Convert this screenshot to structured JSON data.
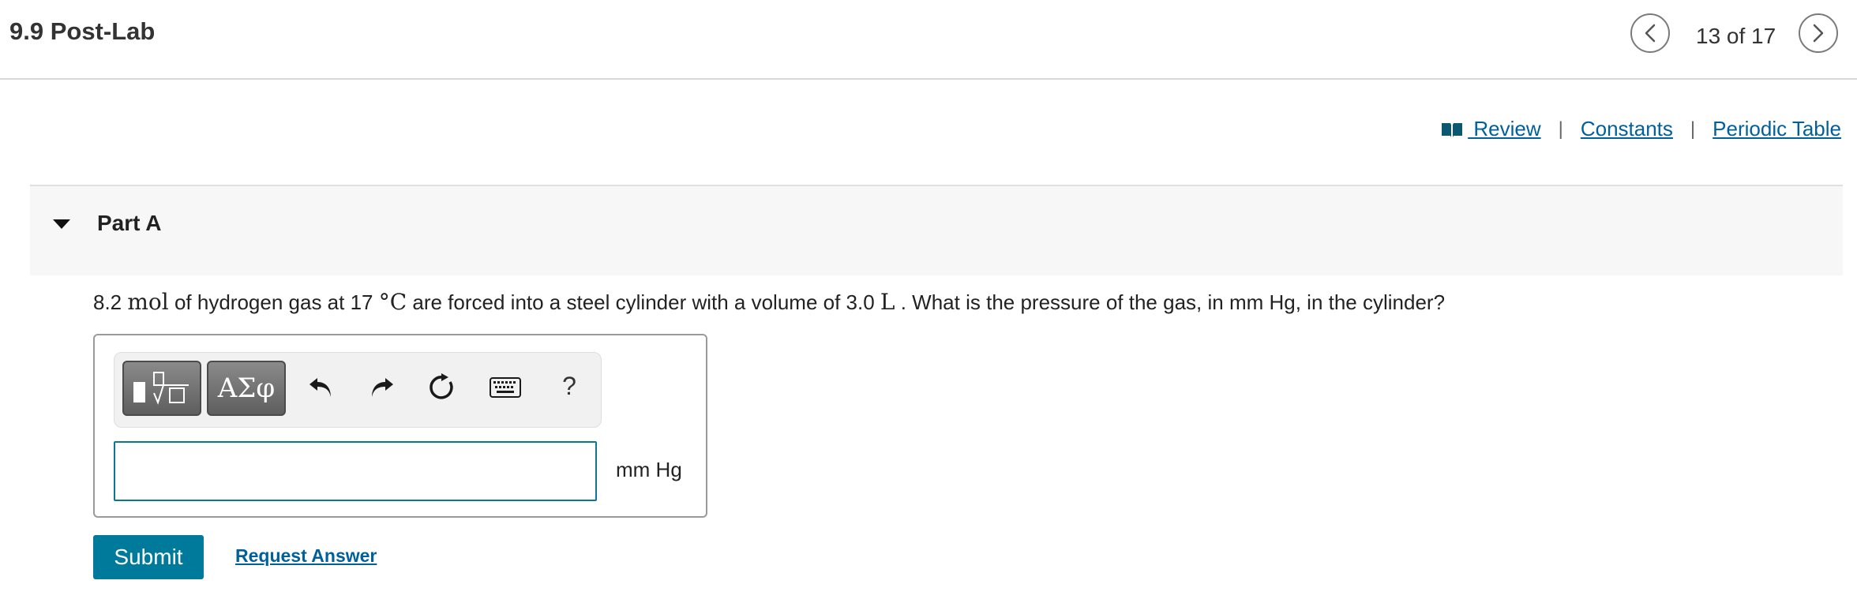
{
  "header": {
    "title": "9.9 Post-Lab",
    "counter": "13 of 17"
  },
  "resource_links": {
    "review": " Review",
    "separator": "|",
    "constants": "Constants",
    "periodic_table": "Periodic Table"
  },
  "part": {
    "label": "Part A"
  },
  "question": {
    "q1": "8.2 ",
    "q_mol": "mol",
    "q2": " of hydrogen gas at 17 ",
    "q_unit_temp": "°C",
    "q3": "  are forced into a steel cylinder with a volume of 3.0 ",
    "q_unit_vol": "L",
    "q4": " . What is the pressure of the gas, in mm Hg, in the cylinder?"
  },
  "toolbar": {
    "symbols_label": "ΑΣφ",
    "help_label": "?"
  },
  "answer": {
    "value": "",
    "unit": "mm Hg"
  },
  "actions": {
    "submit_label": "Submit",
    "request_answer_label": "Request Answer"
  }
}
